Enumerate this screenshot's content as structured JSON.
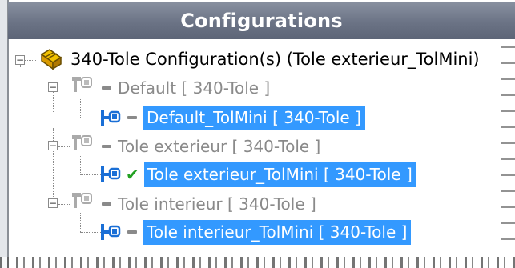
{
  "panel": {
    "title": "Configurations"
  },
  "tree": {
    "root": {
      "label": "340-Tole Configuration(s)  (Tole exterieur_TolMini)",
      "icon": "configuration-root-icon"
    },
    "configurations": [
      {
        "label": "Default [ 340-Tole ]",
        "icon": "configuration-icon",
        "child": {
          "label": "Default_TolMini [ 340-Tole ]",
          "active": false,
          "icon": "derived-configuration-icon"
        }
      },
      {
        "label": "Tole exterieur [ 340-Tole ]",
        "icon": "configuration-icon",
        "child": {
          "label": "Tole exterieur_TolMini [ 340-Tole ]",
          "active": true,
          "icon": "derived-configuration-icon"
        }
      },
      {
        "label": "Tole interieur [ 340-Tole ]",
        "icon": "configuration-icon",
        "child": {
          "label": "Tole interieur_TolMini [ 340-Tole ]",
          "active": false,
          "icon": "derived-configuration-icon"
        }
      }
    ]
  },
  "colors": {
    "header": "#6b7385",
    "selection": "#3399ff",
    "inactive_text": "#8a8a8a",
    "active_check": "#22a022"
  }
}
